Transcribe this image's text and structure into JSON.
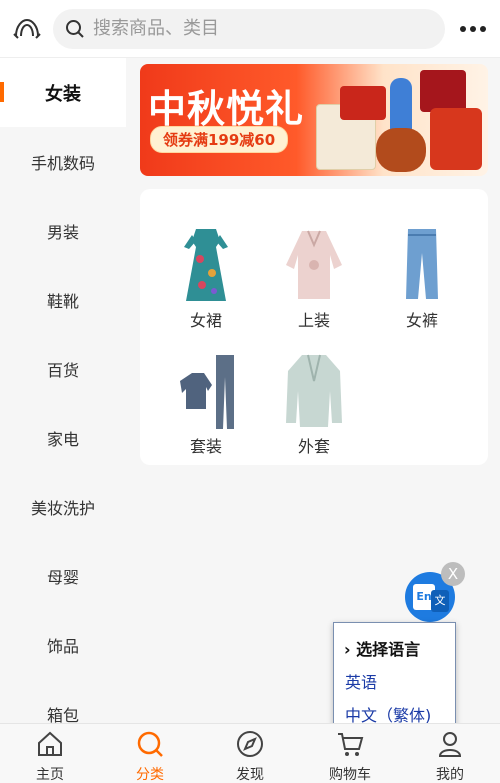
{
  "header": {
    "search_placeholder": "搜索商品、类目"
  },
  "sidebar": {
    "items": [
      {
        "label": "女装",
        "active": true
      },
      {
        "label": "手机数码"
      },
      {
        "label": "男装"
      },
      {
        "label": "鞋靴"
      },
      {
        "label": "百货"
      },
      {
        "label": "家电"
      },
      {
        "label": "美妆洗护"
      },
      {
        "label": "母婴"
      },
      {
        "label": "饰品"
      },
      {
        "label": "箱包"
      }
    ]
  },
  "banner": {
    "title": "中秋悦礼",
    "coupon": "领券满199减60"
  },
  "categories": [
    {
      "label": "女裙",
      "icon": "dress-icon"
    },
    {
      "label": "上装",
      "icon": "blouse-icon"
    },
    {
      "label": "女裤",
      "icon": "jeans-icon"
    },
    {
      "label": "套装",
      "icon": "tracksuit-icon"
    },
    {
      "label": "外套",
      "icon": "blazer-icon"
    }
  ],
  "translate": {
    "close": "X",
    "icon_text_left": "En",
    "icon_text_right": "文",
    "popup_title": "› 选择语言",
    "options": [
      "英语",
      "中文（繁体)"
    ]
  },
  "bottom_nav": [
    {
      "label": "主页",
      "icon": "home-icon"
    },
    {
      "label": "分类",
      "icon": "search-circle-icon",
      "active": true
    },
    {
      "label": "发现",
      "icon": "compass-icon"
    },
    {
      "label": "购物车",
      "icon": "cart-icon"
    },
    {
      "label": "我的",
      "icon": "user-icon"
    }
  ],
  "colors": {
    "accent": "#ff6a00",
    "banner_red": "#f03a1a",
    "translate_blue": "#1e7be0"
  }
}
